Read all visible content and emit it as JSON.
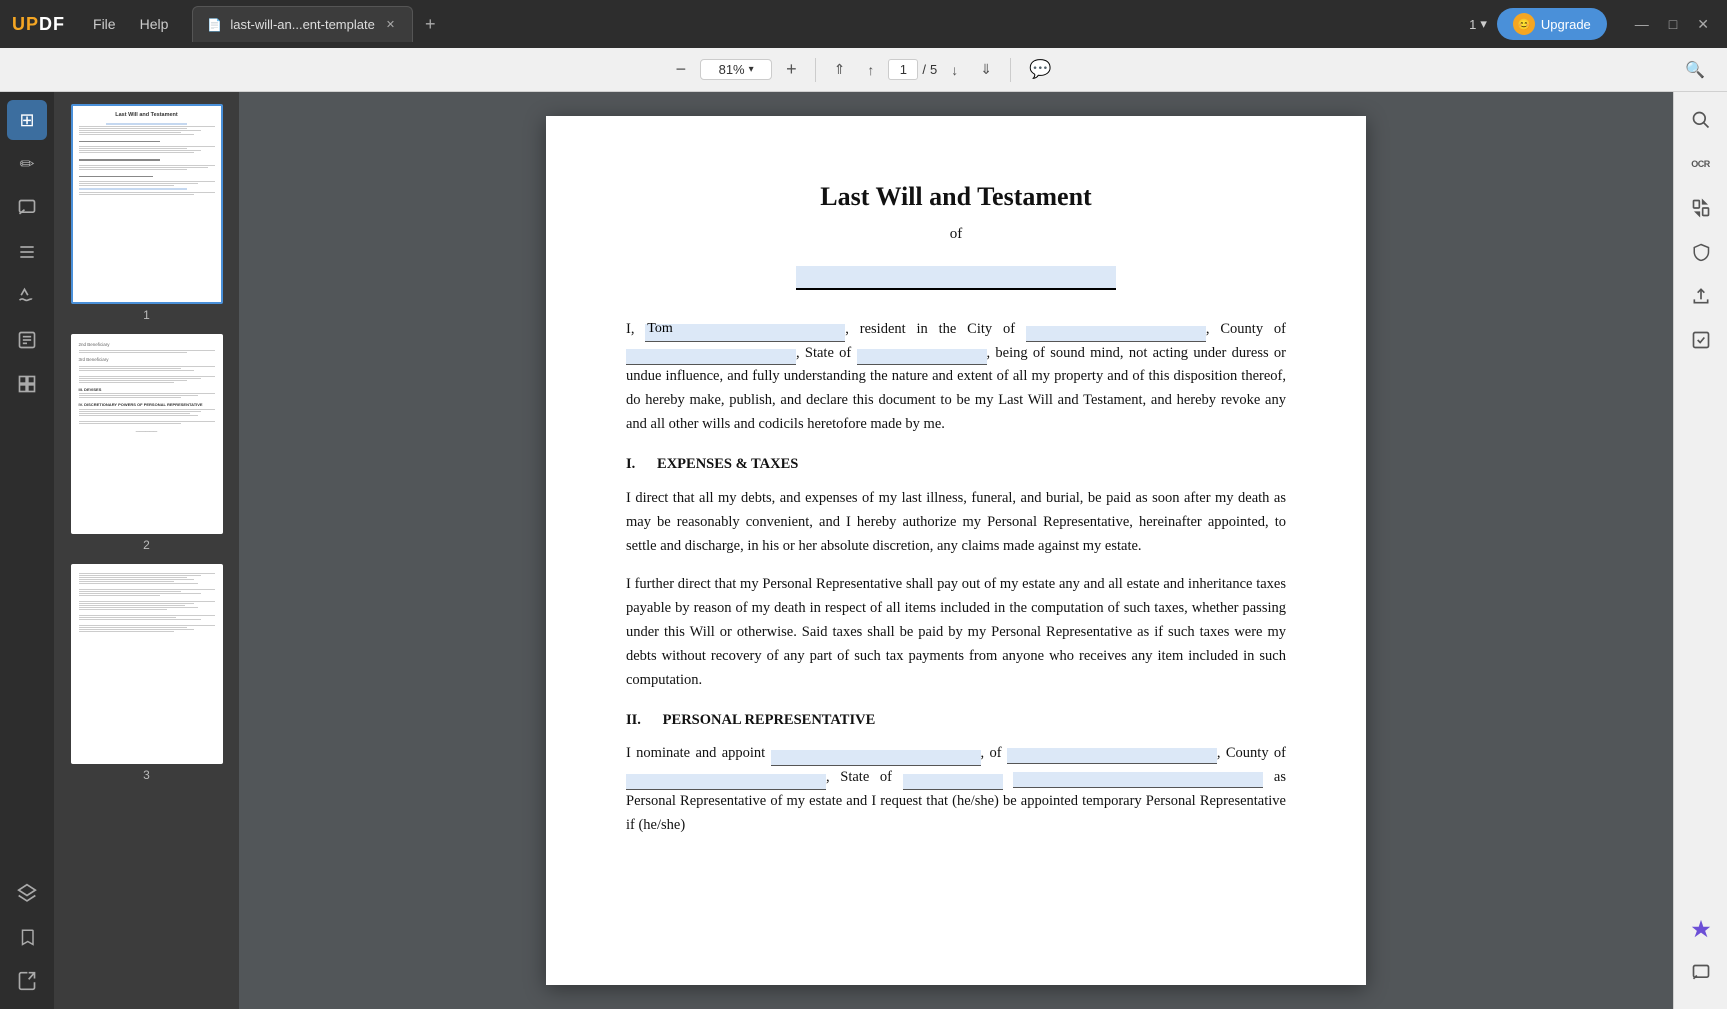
{
  "app": {
    "logo": "UPDF",
    "menu": [
      "File",
      "Help"
    ]
  },
  "tab": {
    "label": "last-will-an...ent-template",
    "icon": "📄"
  },
  "window_controls": {
    "minimize": "—",
    "maximize": "□",
    "close": "✕"
  },
  "toolbar": {
    "zoom_out": "−",
    "zoom_level": "81%",
    "zoom_in": "+",
    "zoom_dropdown": "▾",
    "first_page": "⇑",
    "prev_page": "↑",
    "page_current": "1",
    "page_separator": "/",
    "page_total": "5",
    "next_page": "↓",
    "last_page": "⇓",
    "comment": "💬"
  },
  "upgrade": {
    "label": "Upgrade",
    "avatar": "😊"
  },
  "left_sidebar": {
    "icons": [
      {
        "name": "pages-icon",
        "symbol": "⊞",
        "active": true
      },
      {
        "name": "edit-icon",
        "symbol": "✏"
      },
      {
        "name": "comment-icon",
        "symbol": "💬"
      },
      {
        "name": "list-icon",
        "symbol": "☰"
      },
      {
        "name": "sign-icon",
        "symbol": "✍"
      },
      {
        "name": "form-icon",
        "symbol": "📋"
      },
      {
        "name": "organize-icon",
        "symbol": "⊟"
      },
      {
        "name": "layers-icon",
        "symbol": "⊕"
      },
      {
        "name": "bookmark-icon",
        "symbol": "🔖"
      },
      {
        "name": "attachment-icon",
        "symbol": "📎"
      }
    ]
  },
  "thumbnails": [
    {
      "number": "1",
      "selected": true
    },
    {
      "number": "2",
      "selected": false
    },
    {
      "number": "3",
      "selected": false
    }
  ],
  "document": {
    "title": "Last Will and Testament",
    "subtitle": "of",
    "name_field_value": "Tom",
    "name_field_placeholder": "",
    "body": {
      "intro": "I, {name}, resident in the City of {city}, County of {county}, State of {state}, being of sound mind, not acting under duress or undue influence, and fully understanding the nature and extent of all my property and of this disposition thereof, do hereby make, publish, and declare this document to be my Last Will and Testament, and hereby revoke any and all other wills and codicils heretofore made by me.",
      "section1_num": "I.",
      "section1_title": "EXPENSES & TAXES",
      "section1_p1": "I direct that all my debts, and expenses of my last illness, funeral, and burial, be paid as soon after my death as may be reasonably convenient, and I hereby authorize my Personal Representative, hereinafter appointed, to settle and discharge, in his or her absolute discretion, any claims made against my estate.",
      "section1_p2": "I further direct that my Personal Representative shall pay out of my estate any and all estate and inheritance taxes payable by reason of my death in respect of all items included in the computation of such taxes, whether passing under this Will or otherwise. Said taxes shall be paid by my Personal Representative as if such taxes were my debts without recovery of any part of such tax payments from anyone who receives any item included in such computation.",
      "section2_num": "II.",
      "section2_title": "PERSONAL REPRESENTATIVE",
      "section2_p1": "I nominate and appoint {rep_name}, of {rep_city}, County of {rep_county}, State of {rep_state} as Personal Representative of my estate and I request that (he/she) be appointed temporary Personal Representative if (he/she)"
    }
  },
  "right_sidebar": {
    "icons": [
      {
        "name": "ocr-icon",
        "symbol": "OCR",
        "label": "OCR"
      },
      {
        "name": "convert-icon",
        "symbol": "⇄"
      },
      {
        "name": "security-icon",
        "symbol": "🔒"
      },
      {
        "name": "export-icon",
        "symbol": "↑"
      },
      {
        "name": "check-icon",
        "symbol": "✓"
      },
      {
        "name": "ai-icon",
        "symbol": "✦",
        "accent": true
      }
    ]
  }
}
